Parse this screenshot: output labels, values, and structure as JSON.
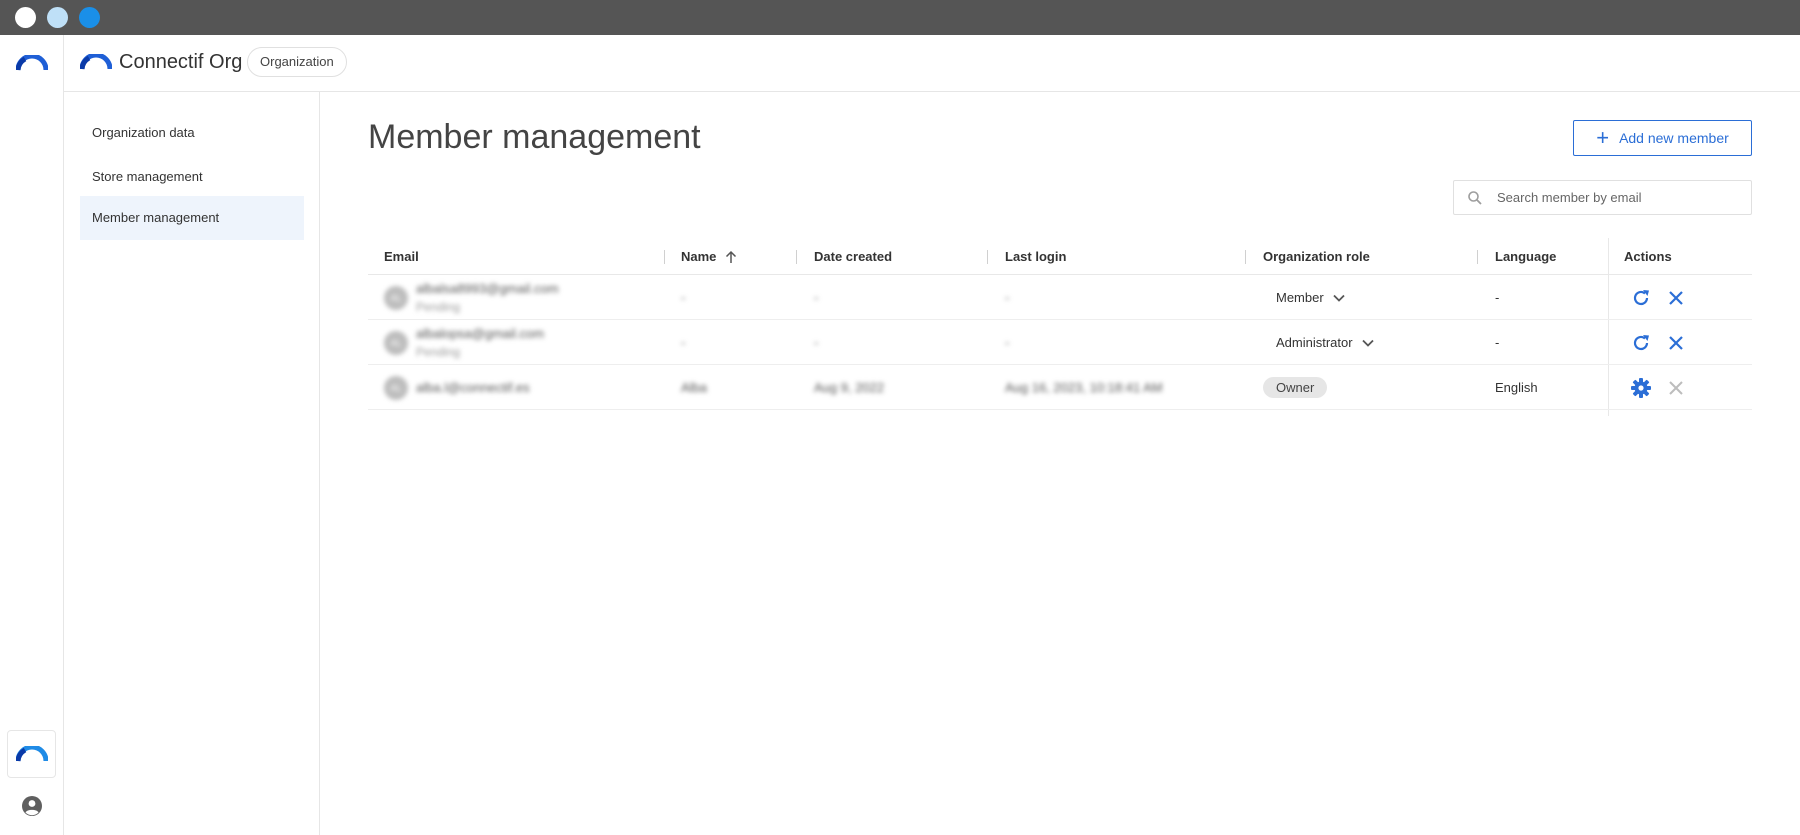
{
  "app": {
    "org_name": "Connectif Org",
    "org_chip": "Organization",
    "brand_color": "#1f5fd6"
  },
  "sidebar": {
    "items": [
      {
        "label": "Organization data"
      },
      {
        "label": "Store management"
      },
      {
        "label": "Member management"
      }
    ]
  },
  "main": {
    "title": "Member management",
    "add_button_label": "Add new member",
    "search_placeholder": "Search member by email"
  },
  "table": {
    "columns": {
      "email": "Email",
      "name": "Name",
      "date_created": "Date created",
      "last_login": "Last login",
      "org_role": "Organization role",
      "language": "Language",
      "actions": "Actions"
    },
    "rows": [
      {
        "initials": "AL",
        "email": "albalsa8993@gmail.com",
        "status": "Pending",
        "name": "-",
        "date_created": "-",
        "last_login": "-",
        "role": "Member",
        "language": "-"
      },
      {
        "initials": "AL",
        "email": "albalopsa@gmail.com",
        "status": "Pending",
        "name": "-",
        "date_created": "-",
        "last_login": "-",
        "role": "Administrator",
        "language": "-"
      },
      {
        "initials": "AL",
        "email": "alba.l@connectif.es",
        "status": "",
        "name": "Alba",
        "date_created": "Aug 9, 2022",
        "last_login": "Aug 16, 2023, 10:18:41 AM",
        "role": "Owner",
        "language": "English"
      }
    ]
  },
  "icons": {
    "logo": "connectif-logo-icon",
    "search": "search-icon",
    "plus": "plus-icon",
    "sort": "sort-arrow-up-icon",
    "dropdown": "chevron-down-icon",
    "resend": "refresh-icon",
    "remove": "close-icon",
    "settings": "gear-icon",
    "user": "user-circle-icon"
  }
}
